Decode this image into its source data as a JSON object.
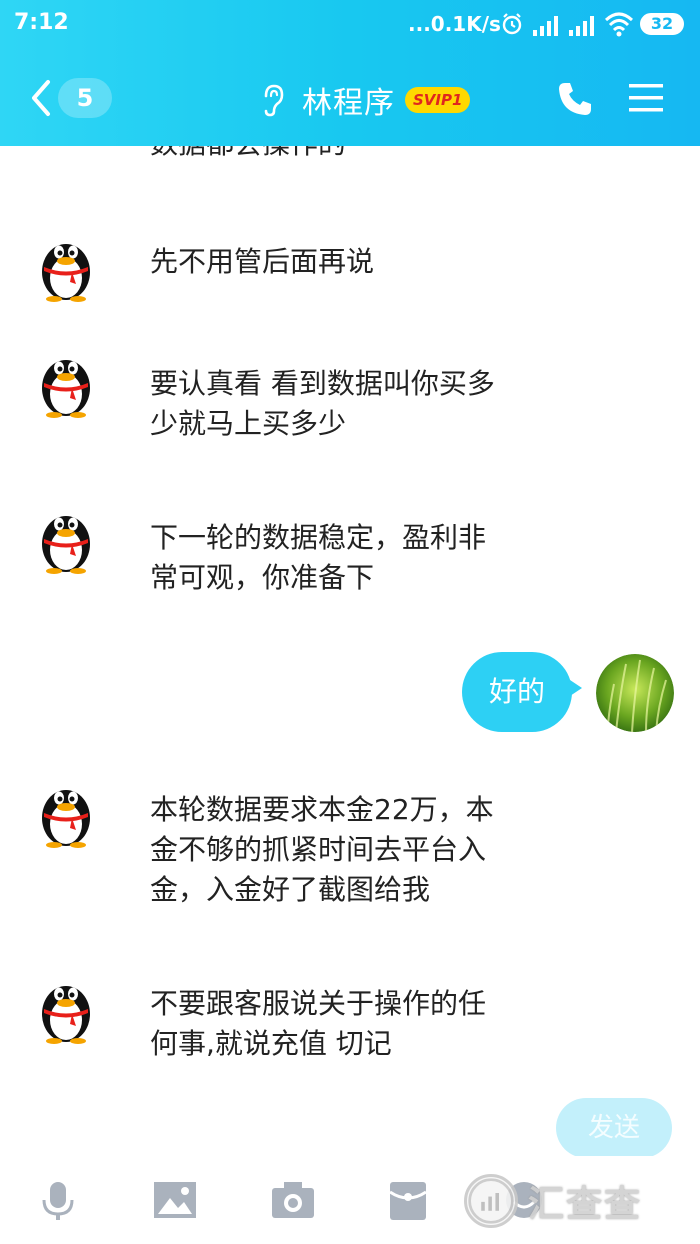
{
  "status_bar": {
    "time": "7:12",
    "net_speed": "...0.1K/s",
    "battery": "32",
    "icons": [
      "alarm-icon",
      "signal-icon",
      "signal-icon",
      "wifi-icon",
      "battery-icon"
    ]
  },
  "header": {
    "back_count": "5",
    "contact_name": "林程序",
    "vip_badge": "SVIP1",
    "icons": [
      "back-chevron-icon",
      "ear-icon",
      "phone-icon",
      "menu-icon"
    ],
    "accent_color": "#18c8f0"
  },
  "chat": {
    "partial_message": "数据都会操作的",
    "messages": [
      {
        "side": "left",
        "text_lines": [
          "先不用管后面再说"
        ]
      },
      {
        "side": "left",
        "text_lines": [
          "要认真看 看到数据叫你买多",
          "少就马上买多少"
        ]
      },
      {
        "side": "left",
        "text_lines": [
          "下一轮的数据稳定，盈利非",
          "常可观，你准备下"
        ]
      },
      {
        "side": "right",
        "text": "好的"
      },
      {
        "side": "left",
        "text_lines": [
          "本轮数据要求本金22万，本",
          "金不够的抓紧时间去平台入",
          "金，入金好了截图给我"
        ]
      },
      {
        "side": "left",
        "text_lines": [
          "不要跟客服说关于操作的任",
          "何事,就说充值 切记"
        ]
      }
    ],
    "bubble_color": "#2dd0f4"
  },
  "input": {
    "send_label": "发送"
  },
  "toolbar": {
    "icons": [
      "microphone-icon",
      "image-icon",
      "camera-icon",
      "red-packet-icon",
      "emoji-icon"
    ]
  },
  "watermark": {
    "text": "汇查查"
  }
}
